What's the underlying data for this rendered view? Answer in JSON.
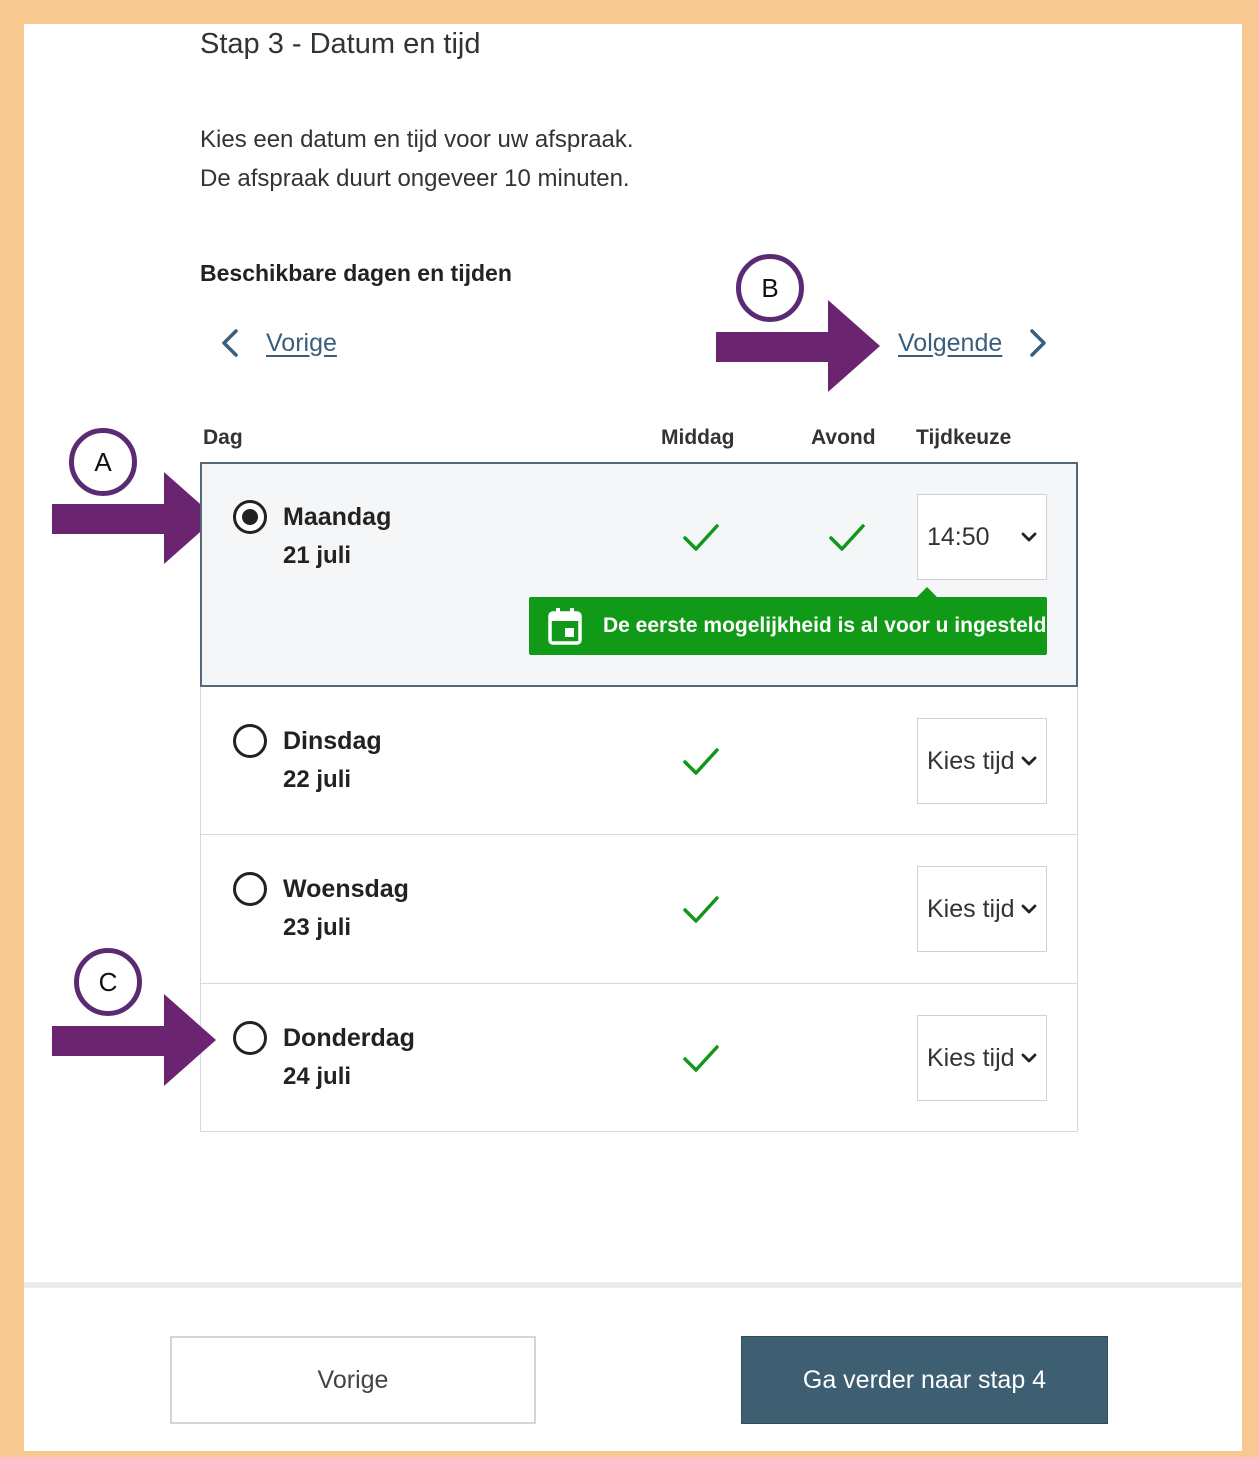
{
  "page": {
    "step_title": "Stap 3 - Datum en tijd",
    "intro_line_1": "Kies een datum en tijd voor uw afspraak.",
    "intro_line_2": "De afspraak duurt ongeveer 10 minuten.",
    "section_heading": "Beschikbare dagen en tijden"
  },
  "nav": {
    "previous_label": "Vorige",
    "next_label": "Volgende"
  },
  "table": {
    "columns": {
      "day": "Dag",
      "afternoon": "Middag",
      "evening": "Avond",
      "time_choice": "Tijdkeuze"
    },
    "days": [
      {
        "day": "Maandag",
        "date": "21 juli",
        "afternoon": true,
        "evening": true,
        "time": "14:50",
        "selected": true
      },
      {
        "day": "Dinsdag",
        "date": "22 juli",
        "afternoon": true,
        "evening": false,
        "time": "Kies tijd",
        "selected": false
      },
      {
        "day": "Woensdag",
        "date": "23 juli",
        "afternoon": true,
        "evening": false,
        "time": "Kies tijd",
        "selected": false
      },
      {
        "day": "Donderdag",
        "date": "24 juli",
        "afternoon": true,
        "evening": false,
        "time": "Kies tijd",
        "selected": false
      }
    ],
    "notice": "De eerste mogelijkheid is al voor u ingesteld"
  },
  "footer": {
    "previous_button": "Vorige",
    "next_button": "Ga verder naar stap 4"
  },
  "annotations": {
    "A": "A",
    "B": "B",
    "C": "C"
  },
  "colors": {
    "frame": "#f7c88f",
    "link": "#3a5f7d",
    "success": "#109a18",
    "primary_button": "#3e5f72",
    "annotation": "#5a2b72"
  }
}
